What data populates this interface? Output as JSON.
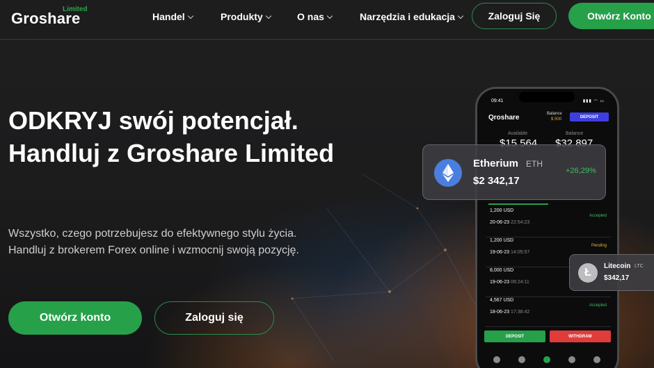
{
  "brand": {
    "name": "Groshare",
    "sub": "Limited",
    "accent": "#27a04a"
  },
  "nav": {
    "items": [
      {
        "label": "Handel"
      },
      {
        "label": "Produkty"
      },
      {
        "label": "O nas"
      },
      {
        "label": "Narzędzia i edukacja"
      }
    ],
    "login_label": "Zaloguj Się",
    "open_label": "Otwórz Konto"
  },
  "hero": {
    "title": "ODKRYJ swój potencjał. Handluj z Groshare Limited",
    "subtitle_line1": "Wszystko, czego potrzebujesz do efektywnego stylu życia.",
    "subtitle_line2": "Handluj z brokerem Forex online i wzmocnij swoją pozycję.",
    "open_label": "Otwórz konto",
    "login_label": "Zaloguj się"
  },
  "phone": {
    "time": "09:41",
    "logo": "Qroshare",
    "balance_label": "Balance",
    "balance_value": "$ 500",
    "deposit_label": "DEPOSIT",
    "available_label": "Available",
    "available_value": "$15 564",
    "balance2_label": "Balance",
    "balance2_value": "$32 897",
    "transactions": [
      {
        "amount": "1,200 USD",
        "date": "20-06-23",
        "time": "22:54:23",
        "status": "Accepted",
        "status_color": "#3fbf5f"
      },
      {
        "amount": "1,200 USD",
        "date": "19-06-23",
        "time": "14:05:57",
        "status": "Pending",
        "status_color": "#e2b53a"
      },
      {
        "amount": "8,000 USD",
        "date": "19-06-23",
        "time": "09:24:11",
        "status": "",
        "status_color": "#3fbf5f"
      },
      {
        "amount": "4,567 USD",
        "date": "18-06-23",
        "time": "17:38:42",
        "status": "Accepted",
        "status_color": "#3fbf5f"
      }
    ],
    "deposit_button": "DEPOSIT",
    "withdraw_button": "WITHDRAW"
  },
  "eth_card": {
    "name": "Etherium",
    "symbol": "ETH",
    "price": "$2 342,17",
    "change": "+26,29%",
    "icon": "ethereum-icon"
  },
  "ltc_card": {
    "name": "Litecoin",
    "symbol": "LTC",
    "price": "$342,17",
    "icon": "litecoin-icon"
  }
}
